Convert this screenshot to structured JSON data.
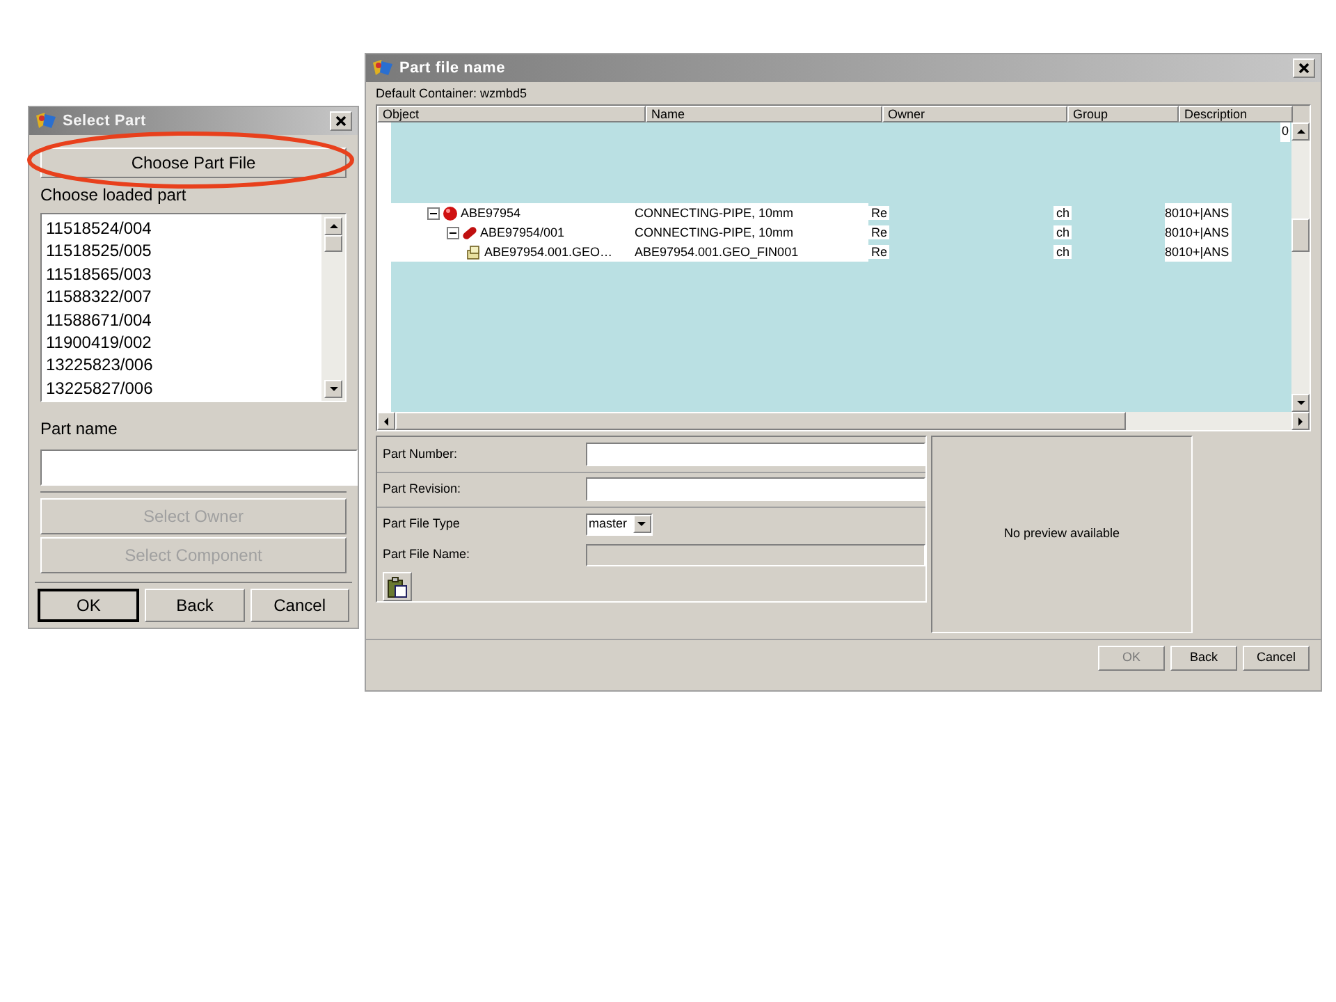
{
  "select_part_dialog": {
    "title": "Select Part",
    "choose_part_file_button": "Choose Part File",
    "loaded_parts_label": "Choose loaded part",
    "loaded_parts": [
      {
        "label": "11518524/004",
        "selected": false
      },
      {
        "label": "11518525/005",
        "selected": false
      },
      {
        "label": "11518565/003",
        "selected": false
      },
      {
        "label": "11588322/007",
        "selected": false
      },
      {
        "label": "11588671/004",
        "selected": false
      },
      {
        "label": "11900419/002",
        "selected": false
      },
      {
        "label": "13225823/006",
        "selected": false
      },
      {
        "label": "13225827/006",
        "selected": false
      }
    ],
    "part_name_label": "Part name",
    "buttons": [
      {
        "label": "Select Owner",
        "disabled": true
      },
      {
        "label": "Select Component",
        "disabled": true
      }
    ],
    "footer_buttons": [
      {
        "label": "OK",
        "default": true
      },
      {
        "label": "Back",
        "default": false
      },
      {
        "label": "Cancel",
        "default": false
      }
    ]
  },
  "part_file_dialog": {
    "title": "Part file name",
    "default_container": "Default Container: wzmbd5",
    "table": {
      "columns": [
        "Object",
        "Name",
        "Owner",
        "Group",
        "Description"
      ],
      "corner_text": "0",
      "rows": [
        {
          "kind": "part",
          "object": "ABE97954",
          "name": "CONNECTING-PIPE, 10mm",
          "owner": "Re",
          "group": "ch",
          "description": "8010+|ANS",
          "expanded": true,
          "children": [
            {
              "kind": "revision",
              "object": "ABE97954/001",
              "name": "CONNECTING-PIPE, 10mm",
              "owner": "Re",
              "group": "ch",
              "description": "8010+|ANS",
              "expanded": true,
              "children": [
                {
                  "kind": "file",
                  "object": "ABE97954.001.GEO…",
                  "name": "ABE97954.001.GEO_FIN001",
                  "owner": "Re",
                  "group": "ch",
                  "description": "8010+|ANS"
                }
              ]
            }
          ]
        }
      ]
    },
    "fields": [
      {
        "kind": "text",
        "label": "Part Number:"
      },
      {
        "kind": "text",
        "label": "Part Revision:"
      },
      {
        "kind": "select",
        "label": "Part File Type",
        "value": "master"
      },
      {
        "kind": "readonly",
        "label": "Part File Name:"
      }
    ],
    "preview": "No preview available",
    "footer_buttons": [
      {
        "label": "OK",
        "disabled": true
      },
      {
        "label": "Back",
        "disabled": false
      },
      {
        "label": "Cancel",
        "disabled": false
      }
    ]
  }
}
